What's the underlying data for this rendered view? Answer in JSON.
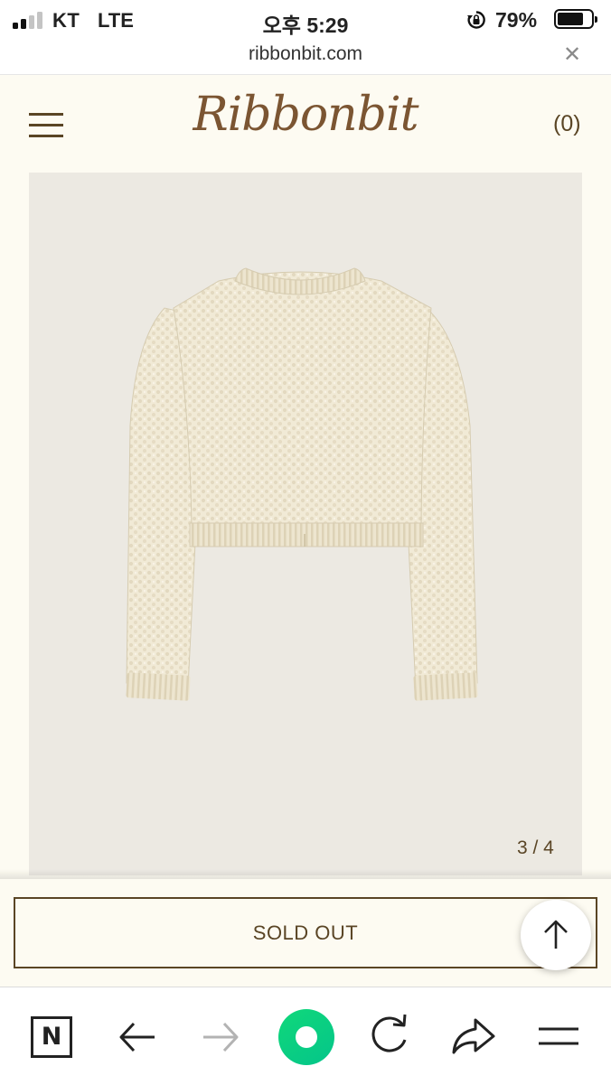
{
  "status_bar": {
    "carrier": "KT",
    "network": "LTE",
    "time": "오후 5:29",
    "battery": "79%",
    "battery_level": 0.79
  },
  "browser": {
    "url": "ribbonbit.com"
  },
  "header": {
    "logo": "Ribbonbit",
    "cart": "(0)"
  },
  "product": {
    "image_counter": "3 / 4",
    "sold_out_label": "SOLD OUT"
  },
  "colors": {
    "page_background": "#fdfbf2",
    "brand_brown": "#7b5532",
    "image_background": "#ece9e2",
    "naver_green": "#03c75a"
  },
  "icons": {
    "menu": "hamburger-icon",
    "scroll_top": "arrow-up-icon",
    "toolbar": [
      "naver-n-icon",
      "back-arrow-icon",
      "forward-arrow-icon",
      "green-home-icon",
      "refresh-icon",
      "share-icon",
      "menu-icon"
    ]
  }
}
